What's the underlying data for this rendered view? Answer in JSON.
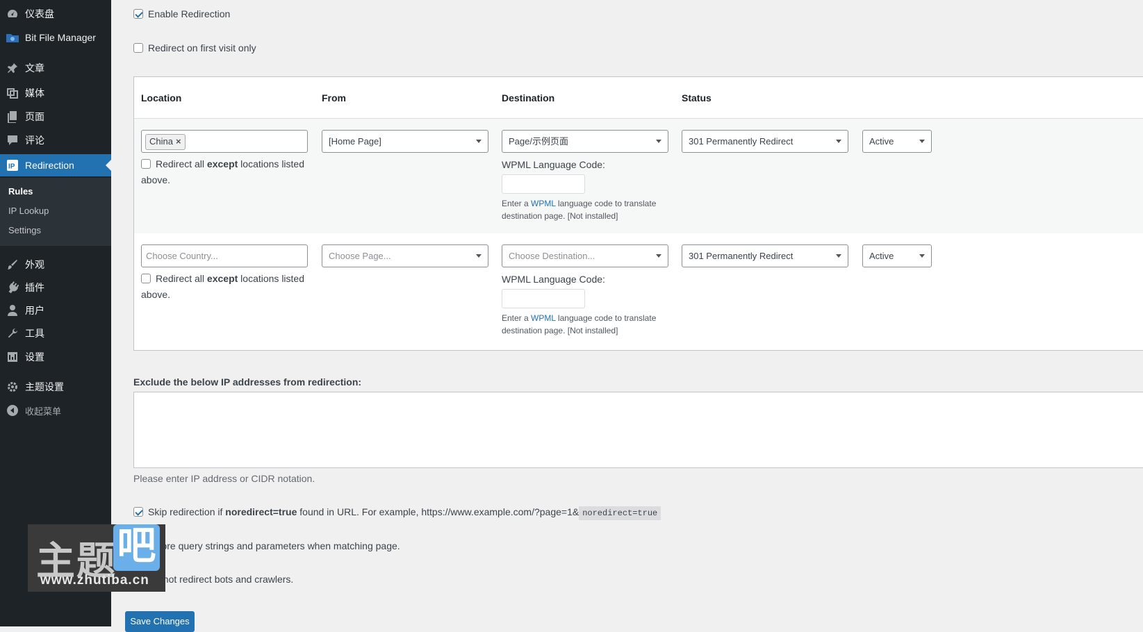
{
  "sidebar": {
    "items": [
      {
        "label": "仪表盘",
        "icon": "dashboard-icon"
      },
      {
        "label": "Bit File Manager",
        "icon": "folder-icon"
      },
      {
        "label": "文章",
        "icon": "pin-icon"
      },
      {
        "label": "媒体",
        "icon": "media-icon"
      },
      {
        "label": "页面",
        "icon": "page-icon"
      },
      {
        "label": "评论",
        "icon": "comment-icon"
      },
      {
        "label": "Redirection",
        "icon": "ip-icon"
      },
      {
        "label": "外观",
        "icon": "brush-icon"
      },
      {
        "label": "插件",
        "icon": "plugin-icon"
      },
      {
        "label": "用户",
        "icon": "user-icon"
      },
      {
        "label": "工具",
        "icon": "wrench-icon"
      },
      {
        "label": "设置",
        "icon": "settings-icon"
      },
      {
        "label": "主题设置",
        "icon": "gear-icon"
      },
      {
        "label": "收起菜单",
        "icon": "collapse-icon"
      }
    ],
    "submenu": [
      "Rules",
      "IP Lookup",
      "Settings"
    ]
  },
  "options": {
    "enable_redirection": {
      "label": "Enable Redirection",
      "checked": true
    },
    "first_visit": {
      "label": "Redirect on first visit only",
      "checked": false
    }
  },
  "table": {
    "headers": [
      "Location",
      "From",
      "Destination",
      "Status"
    ],
    "rows": [
      {
        "location_tag": "China",
        "except_label_pre": "Redirect all ",
        "except_label_bold": "except",
        "except_label_post": " locations listed above.",
        "from": "[Home Page]",
        "destination": "Page/示例页面",
        "wpml_label": "WPML Language Code:",
        "wpml_help_pre": "Enter a ",
        "wpml_link": "WPML",
        "wpml_help_post": " language code to translate destination page. [Not installed]",
        "redirect_type": "301 Permanently Redirect",
        "status": "Active"
      },
      {
        "location_placeholder": "Choose Country...",
        "except_label_pre": "Redirect all ",
        "except_label_bold": "except",
        "except_label_post": " locations listed above.",
        "from_placeholder": "Choose Page...",
        "destination_placeholder": "Choose Destination...",
        "wpml_label": "WPML Language Code:",
        "wpml_help_pre": "Enter a ",
        "wpml_link": "WPML",
        "wpml_help_post": " language code to translate destination page. [Not installed]",
        "redirect_type": "301 Permanently Redirect",
        "status": "Active"
      }
    ]
  },
  "exclude": {
    "label": "Exclude the below IP addresses from redirection:",
    "help": "Please enter IP address or CIDR notation."
  },
  "bottom_options": {
    "skip_pre": "Skip redirection if ",
    "skip_bold": "noredirect=true",
    "skip_post": " found in URL. For example, https://www.example.com/?page=1&",
    "skip_code": "noredirect=true",
    "ignore_query": "Ignore query strings and parameters when matching page.",
    "no_bots": "Do not redirect bots and crawlers."
  },
  "save_button": "Save Changes",
  "watermark": {
    "big": "主题",
    "badge": "吧",
    "url": "www.zhutiba.cn"
  }
}
